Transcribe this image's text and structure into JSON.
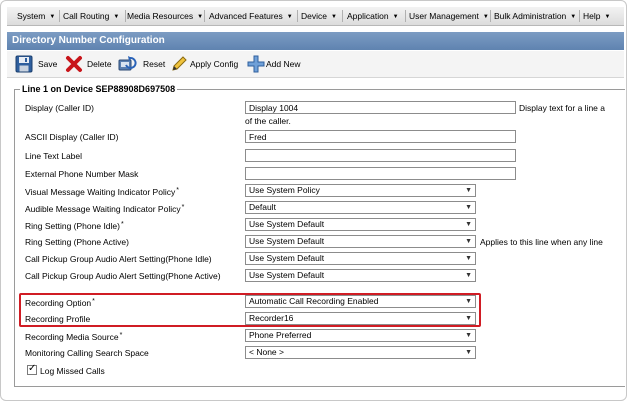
{
  "menubar": {
    "items": [
      {
        "label": "System"
      },
      {
        "label": "Call Routing"
      },
      {
        "label": "Media Resources"
      },
      {
        "label": "Advanced Features"
      },
      {
        "label": "Device"
      },
      {
        "label": "Application"
      },
      {
        "label": "User Management"
      },
      {
        "label": "Bulk Administration"
      },
      {
        "label": "Help"
      }
    ]
  },
  "page": {
    "title": "Directory Number Configuration"
  },
  "toolbar": {
    "save_label": "Save",
    "delete_label": "Delete",
    "reset_label": "Reset",
    "apply_config_label": "Apply Config",
    "add_new_label": "Add New"
  },
  "section": {
    "legend": "Line 1 on Device SEP88908D697508"
  },
  "fields": {
    "display": {
      "label": "Display (Caller ID)",
      "value": "Display 1004",
      "note_line1": "Display text for a line a",
      "note_line2": "of the caller."
    },
    "ascii_display": {
      "label": "ASCII Display (Caller ID)",
      "value": "Fred"
    },
    "line_text_label": {
      "label": "Line Text Label",
      "value": ""
    },
    "external_mask": {
      "label": "External Phone Number Mask",
      "value": ""
    },
    "vmwi_policy": {
      "label": "Visual Message Waiting Indicator Policy",
      "required": "*",
      "value": "Use System Policy"
    },
    "amwi_policy": {
      "label": "Audible Message Waiting Indicator Policy",
      "required": "*",
      "value": "Default"
    },
    "ring_idle": {
      "label": "Ring Setting (Phone Idle)",
      "required": "*",
      "value": "Use System Default"
    },
    "ring_active": {
      "label": "Ring Setting (Phone Active)",
      "value": "Use System Default",
      "note": "Applies to this line when any line"
    },
    "pickup_idle": {
      "label": "Call Pickup Group Audio Alert Setting(Phone Idle)",
      "value": "Use System Default"
    },
    "pickup_active": {
      "label": "Call Pickup Group Audio Alert Setting(Phone Active)",
      "value": "Use System Default"
    },
    "recording_option": {
      "label": "Recording Option",
      "required": "*",
      "value": "Automatic Call Recording Enabled"
    },
    "recording_profile": {
      "label": "Recording Profile",
      "value": "Recorder16"
    },
    "recording_media_source": {
      "label": "Recording Media Source",
      "required": "*",
      "value": "Phone Preferred"
    },
    "monitoring_css": {
      "label": "Monitoring Calling Search Space",
      "value": "< None >"
    },
    "log_missed": {
      "label": "Log Missed Calls",
      "checked": true
    }
  },
  "colors": {
    "title_bar": "#6b8cb8",
    "highlight_border": "#d01c24"
  },
  "icons": {
    "save": "floppy-disk-icon",
    "delete": "red-x-icon",
    "reset": "reset-icon",
    "apply_config": "pencil-icon",
    "add_new": "plus-icon"
  }
}
